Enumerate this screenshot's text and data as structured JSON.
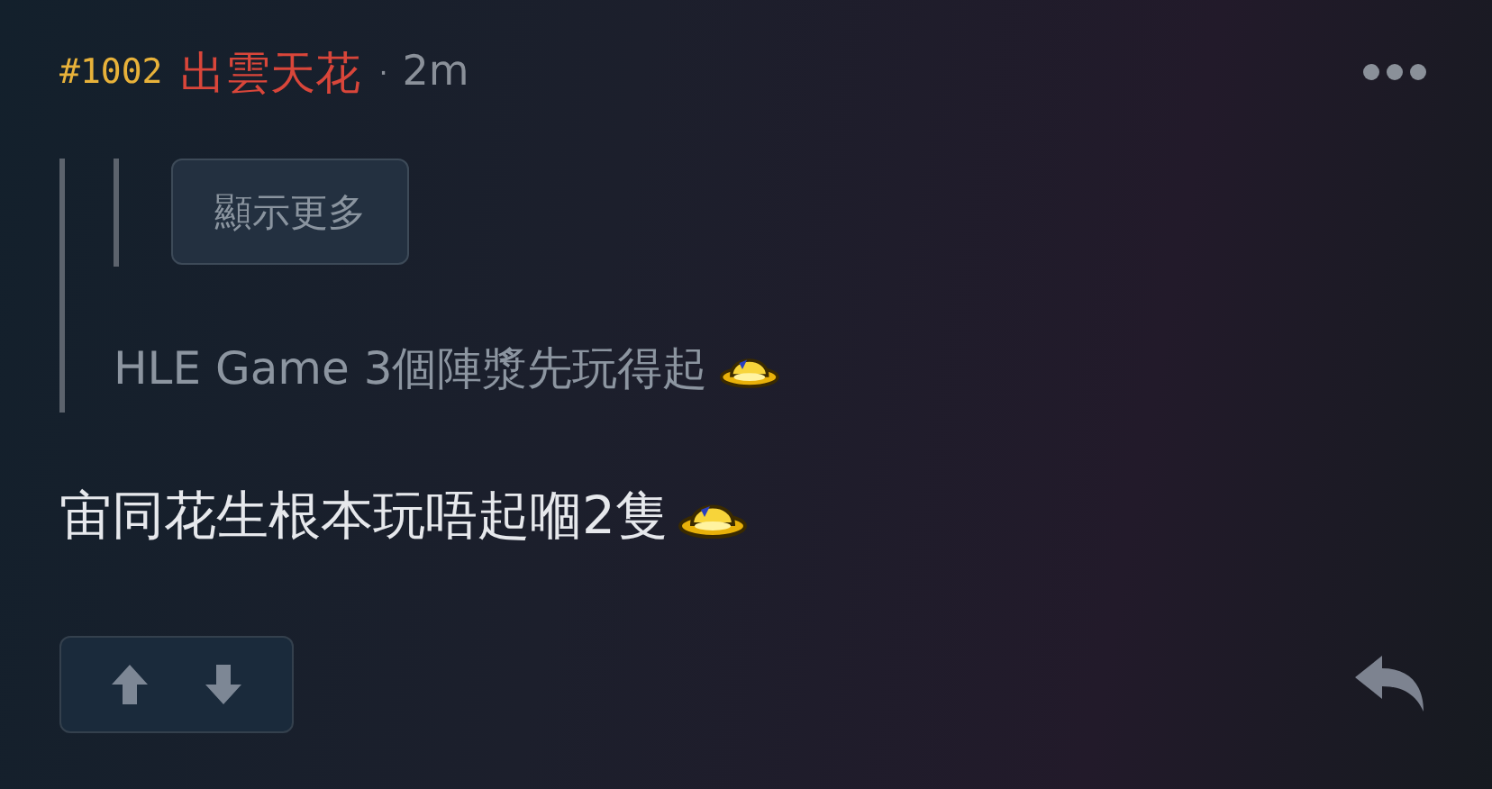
{
  "post": {
    "number": "#1002",
    "author": "出雲天花",
    "separator": "·",
    "time": "2m"
  },
  "quote": {
    "nested": {
      "show_more": "顯示更多"
    },
    "text": "HLE Game 3個陣漿先玩得起"
  },
  "body": {
    "text": "宙同花生根本玩唔起嗰2隻"
  }
}
